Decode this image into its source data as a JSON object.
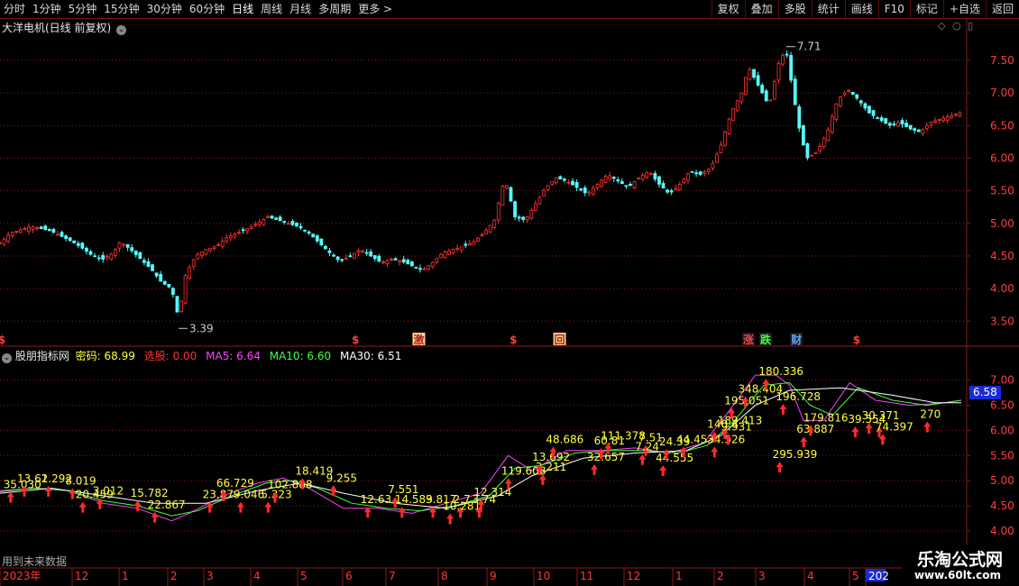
{
  "toolbar": {
    "left": [
      "分时",
      "1分钟",
      "5分钟",
      "15分钟",
      "30分钟",
      "60分钟",
      "日线",
      "周线",
      "月线",
      "多周期",
      "更多 >"
    ],
    "active": "日线",
    "right": [
      "复权",
      "叠加",
      "多股",
      "统计",
      "画线",
      "F10",
      "标记",
      "+自选",
      "返回"
    ]
  },
  "stock_title": "大洋电机(日线 前复权)",
  "indicator": {
    "name": "股朋指标网",
    "mima_label": "密码: 68.99",
    "xuangu_label": "选股: 0.00",
    "ma5_label": "MA5: 6.64",
    "ma10_label": "MA10: 6.60",
    "ma30_label": "MA30: 6.51",
    "current_value": "6.58"
  },
  "footer_note": "用到未来数据",
  "watermark": {
    "title": "乐淘公式网",
    "url": "www.60lt.com"
  },
  "colors": {
    "up": "#ff3232",
    "down": "#54fcfc",
    "ma5": "#ff40ff",
    "ma10": "#40ff40",
    "ma30": "#ffffff",
    "label": "#ffff40",
    "grid": "#8b1a1a"
  },
  "chart_data": [
    {
      "type": "candlestick",
      "title": "大洋电机(日线 前复权)",
      "y_ticks": [
        "7.50",
        "7.00",
        "6.50",
        "6.00",
        "5.50",
        "5.00",
        "4.50",
        "4.00",
        "3.50"
      ],
      "ylim": [
        3.2,
        7.9
      ],
      "annotations": [
        {
          "text": "7.71",
          "value": 7.71
        },
        {
          "text": "3.39",
          "value": 3.39
        }
      ],
      "event_markers": [
        "$",
        "$",
        "激",
        "$",
        "回",
        "涨",
        "跌",
        "财",
        "$"
      ],
      "close_path": [
        [
          0,
          4.7
        ],
        [
          6,
          4.85
        ],
        [
          12,
          4.9
        ],
        [
          18,
          4.95
        ],
        [
          24,
          4.92
        ],
        [
          30,
          4.88
        ],
        [
          36,
          4.8
        ],
        [
          42,
          4.72
        ],
        [
          48,
          4.62
        ],
        [
          54,
          4.5
        ],
        [
          60,
          4.45
        ],
        [
          66,
          4.55
        ],
        [
          70,
          4.72
        ],
        [
          76,
          4.6
        ],
        [
          82,
          4.45
        ],
        [
          88,
          4.3
        ],
        [
          94,
          4.1
        ],
        [
          100,
          4.0
        ],
        [
          104,
          3.55
        ],
        [
          108,
          4.2
        ],
        [
          114,
          4.5
        ],
        [
          120,
          4.6
        ],
        [
          126,
          4.65
        ],
        [
          132,
          4.78
        ],
        [
          138,
          4.85
        ],
        [
          144,
          4.92
        ],
        [
          150,
          5.0
        ],
        [
          156,
          5.1
        ],
        [
          162,
          5.05
        ],
        [
          168,
          5.0
        ],
        [
          174,
          4.95
        ],
        [
          180,
          4.85
        ],
        [
          186,
          4.7
        ],
        [
          192,
          4.55
        ],
        [
          198,
          4.42
        ],
        [
          204,
          4.5
        ],
        [
          210,
          4.6
        ],
        [
          216,
          4.5
        ],
        [
          222,
          4.4
        ],
        [
          228,
          4.45
        ],
        [
          234,
          4.42
        ],
        [
          240,
          4.35
        ],
        [
          246,
          4.28
        ],
        [
          252,
          4.4
        ],
        [
          258,
          4.55
        ],
        [
          264,
          4.6
        ],
        [
          270,
          4.65
        ],
        [
          276,
          4.72
        ],
        [
          282,
          4.85
        ],
        [
          288,
          5.05
        ],
        [
          294,
          5.7
        ],
        [
          300,
          5.1
        ],
        [
          306,
          5.05
        ],
        [
          312,
          5.3
        ],
        [
          318,
          5.55
        ],
        [
          324,
          5.7
        ],
        [
          330,
          5.65
        ],
        [
          336,
          5.55
        ],
        [
          342,
          5.45
        ],
        [
          348,
          5.6
        ],
        [
          354,
          5.75
        ],
        [
          360,
          5.65
        ],
        [
          366,
          5.55
        ],
        [
          372,
          5.7
        ],
        [
          378,
          5.8
        ],
        [
          384,
          5.6
        ],
        [
          390,
          5.45
        ],
        [
          396,
          5.6
        ],
        [
          402,
          5.8
        ],
        [
          408,
          5.75
        ],
        [
          414,
          5.85
        ],
        [
          420,
          6.2
        ],
        [
          426,
          6.7
        ],
        [
          432,
          7.0
        ],
        [
          436,
          7.4
        ],
        [
          442,
          7.1
        ],
        [
          448,
          6.8
        ],
        [
          454,
          7.5
        ],
        [
          458,
          7.65
        ],
        [
          462,
          7.0
        ],
        [
          466,
          6.4
        ],
        [
          470,
          6.0
        ],
        [
          476,
          6.1
        ],
        [
          482,
          6.4
        ],
        [
          488,
          6.9
        ],
        [
          494,
          7.05
        ],
        [
          500,
          6.9
        ],
        [
          506,
          6.7
        ],
        [
          512,
          6.6
        ],
        [
          518,
          6.5
        ],
        [
          524,
          6.55
        ],
        [
          530,
          6.45
        ],
        [
          536,
          6.4
        ],
        [
          542,
          6.55
        ],
        [
          548,
          6.6
        ],
        [
          554,
          6.65
        ],
        [
          560,
          6.7
        ]
      ]
    },
    {
      "type": "line",
      "title": "股朋指标网",
      "y_ticks": [
        "7.00",
        "6.50",
        "6.00",
        "5.50",
        "5.00",
        "4.50",
        "4.00"
      ],
      "ylim": [
        3.8,
        7.3
      ],
      "series": [
        {
          "name": "MA5",
          "path": [
            [
              0,
              4.8
            ],
            [
              20,
              4.85
            ],
            [
              40,
              4.8
            ],
            [
              60,
              4.55
            ],
            [
              80,
              4.45
            ],
            [
              100,
              4.2
            ],
            [
              110,
              4.35
            ],
            [
              130,
              4.7
            ],
            [
              150,
              4.95
            ],
            [
              165,
              5.05
            ],
            [
              180,
              4.85
            ],
            [
              200,
              4.45
            ],
            [
              220,
              4.45
            ],
            [
              240,
              4.35
            ],
            [
              260,
              4.55
            ],
            [
              280,
              4.75
            ],
            [
              296,
              5.5
            ],
            [
              310,
              5.2
            ],
            [
              330,
              5.6
            ],
            [
              350,
              5.6
            ],
            [
              370,
              5.65
            ],
            [
              390,
              5.55
            ],
            [
              410,
              5.75
            ],
            [
              425,
              6.4
            ],
            [
              440,
              7.1
            ],
            [
              452,
              7.1
            ],
            [
              460,
              6.9
            ],
            [
              468,
              6.2
            ],
            [
              480,
              6.2
            ],
            [
              495,
              6.95
            ],
            [
              510,
              6.6
            ],
            [
              530,
              6.5
            ],
            [
              550,
              6.55
            ],
            [
              560,
              6.6
            ]
          ]
        },
        {
          "name": "MA10",
          "path": [
            [
              0,
              4.78
            ],
            [
              20,
              4.85
            ],
            [
              40,
              4.8
            ],
            [
              60,
              4.6
            ],
            [
              80,
              4.5
            ],
            [
              100,
              4.3
            ],
            [
              115,
              4.4
            ],
            [
              135,
              4.7
            ],
            [
              155,
              4.95
            ],
            [
              170,
              5.0
            ],
            [
              185,
              4.85
            ],
            [
              205,
              4.55
            ],
            [
              225,
              4.45
            ],
            [
              245,
              4.4
            ],
            [
              265,
              4.5
            ],
            [
              285,
              4.7
            ],
            [
              300,
              5.25
            ],
            [
              315,
              5.3
            ],
            [
              335,
              5.55
            ],
            [
              355,
              5.6
            ],
            [
              375,
              5.6
            ],
            [
              395,
              5.55
            ],
            [
              412,
              5.7
            ],
            [
              428,
              6.2
            ],
            [
              445,
              6.9
            ],
            [
              460,
              6.95
            ],
            [
              472,
              6.5
            ],
            [
              485,
              6.3
            ],
            [
              500,
              6.85
            ],
            [
              520,
              6.6
            ],
            [
              540,
              6.5
            ],
            [
              560,
              6.6
            ]
          ]
        },
        {
          "name": "MA30",
          "path": [
            [
              0,
              4.75
            ],
            [
              30,
              4.85
            ],
            [
              60,
              4.7
            ],
            [
              90,
              4.55
            ],
            [
              120,
              4.55
            ],
            [
              150,
              4.8
            ],
            [
              175,
              4.95
            ],
            [
              200,
              4.75
            ],
            [
              230,
              4.55
            ],
            [
              260,
              4.45
            ],
            [
              290,
              4.7
            ],
            [
              310,
              5.1
            ],
            [
              340,
              5.45
            ],
            [
              370,
              5.55
            ],
            [
              400,
              5.6
            ],
            [
              420,
              5.9
            ],
            [
              440,
              6.5
            ],
            [
              460,
              6.8
            ],
            [
              490,
              6.85
            ],
            [
              520,
              6.7
            ],
            [
              545,
              6.55
            ],
            [
              560,
              6.55
            ]
          ]
        }
      ],
      "value_labels": [
        {
          "text": "35.030",
          "x": 2,
          "y": 4.85
        },
        {
          "text": "13.61",
          "x": 10,
          "y": 4.97
        },
        {
          "text": "2.292",
          "x": 24,
          "y": 4.97
        },
        {
          "text": "8.019",
          "x": 38,
          "y": 4.92
        },
        {
          "text": "20.459",
          "x": 44,
          "y": 4.65
        },
        {
          "text": "3.012",
          "x": 54,
          "y": 4.72
        },
        {
          "text": "15.782",
          "x": 76,
          "y": 4.68
        },
        {
          "text": "22.867",
          "x": 86,
          "y": 4.45
        },
        {
          "text": "23.87",
          "x": 118,
          "y": 4.65
        },
        {
          "text": "66.729",
          "x": 126,
          "y": 4.88
        },
        {
          "text": "9.046",
          "x": 136,
          "y": 4.65
        },
        {
          "text": "5.323",
          "x": 152,
          "y": 4.65
        },
        {
          "text": "102.888",
          "x": 156,
          "y": 4.85
        },
        {
          "text": "18.419",
          "x": 172,
          "y": 5.12
        },
        {
          "text": "9.255",
          "x": 190,
          "y": 4.98
        },
        {
          "text": "12.63",
          "x": 210,
          "y": 4.55
        },
        {
          "text": "7.551",
          "x": 226,
          "y": 4.75
        },
        {
          "text": "14.589",
          "x": 230,
          "y": 4.55
        },
        {
          "text": "3.817",
          "x": 248,
          "y": 4.55
        },
        {
          "text": "2.7",
          "x": 264,
          "y": 4.55
        },
        {
          "text": "10.281",
          "x": 258,
          "y": 4.42
        },
        {
          "text": "3.74",
          "x": 275,
          "y": 4.55
        },
        {
          "text": "12.314",
          "x": 276,
          "y": 4.7
        },
        {
          "text": "119.608",
          "x": 292,
          "y": 5.12
        },
        {
          "text": "3.211",
          "x": 312,
          "y": 5.2
        },
        {
          "text": "13.692",
          "x": 310,
          "y": 5.4
        },
        {
          "text": "48.686",
          "x": 318,
          "y": 5.75
        },
        {
          "text": "32.657",
          "x": 342,
          "y": 5.4
        },
        {
          "text": "111.378",
          "x": 350,
          "y": 5.82
        },
        {
          "text": "60.81",
          "x": 346,
          "y": 5.72
        },
        {
          "text": "7.51",
          "x": 372,
          "y": 5.78
        },
        {
          "text": "7.24",
          "x": 370,
          "y": 5.6
        },
        {
          "text": "44.555",
          "x": 382,
          "y": 5.38
        },
        {
          "text": "24.39",
          "x": 384,
          "y": 5.7
        },
        {
          "text": "44.453",
          "x": 394,
          "y": 5.75
        },
        {
          "text": "34.526",
          "x": 412,
          "y": 5.75
        },
        {
          "text": "140.4",
          "x": 412,
          "y": 6.05
        },
        {
          "text": "189.413",
          "x": 418,
          "y": 6.12
        },
        {
          "text": "9.931",
          "x": 420,
          "y": 6.0
        },
        {
          "text": "195.051",
          "x": 422,
          "y": 6.52
        },
        {
          "text": "348.404",
          "x": 430,
          "y": 6.75
        },
        {
          "text": "180.336",
          "x": 442,
          "y": 7.1
        },
        {
          "text": "196.728",
          "x": 452,
          "y": 6.6
        },
        {
          "text": "295.939",
          "x": 450,
          "y": 5.45
        },
        {
          "text": "63.887",
          "x": 464,
          "y": 5.95
        },
        {
          "text": "179.816",
          "x": 468,
          "y": 6.18
        },
        {
          "text": "39.5",
          "x": 494,
          "y": 6.15
        },
        {
          "text": "30.371",
          "x": 502,
          "y": 6.22
        },
        {
          "text": "54",
          "x": 508,
          "y": 6.15
        },
        {
          "text": "74.397",
          "x": 510,
          "y": 6.0
        },
        {
          "text": "270",
          "x": 536,
          "y": 6.25
        }
      ]
    }
  ],
  "time_axis": [
    "2023年",
    "12",
    "1",
    "2",
    "3",
    "4",
    "5",
    "6",
    "7",
    "8",
    "9",
    "10",
    "11",
    "12",
    "1",
    "2",
    "3",
    "4",
    "5",
    "202"
  ]
}
